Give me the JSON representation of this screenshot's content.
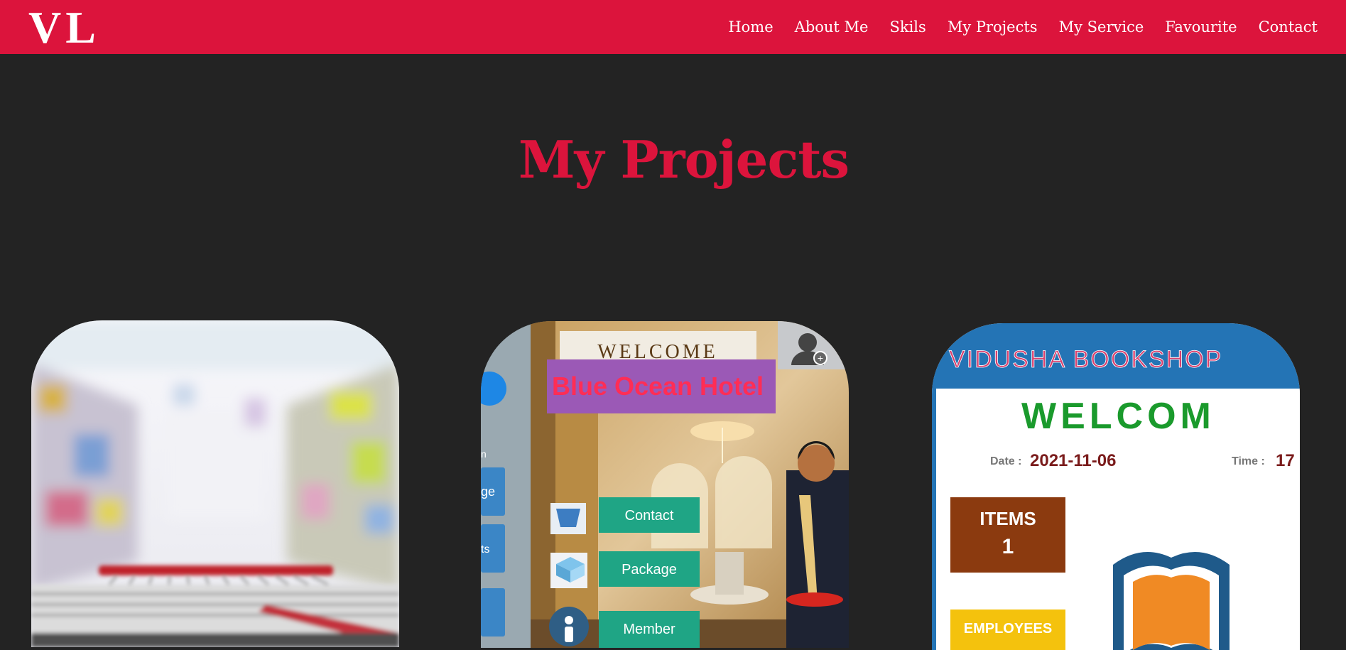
{
  "brand": {
    "logo": "VL"
  },
  "nav": {
    "links": [
      {
        "label": "Home"
      },
      {
        "label": "About Me"
      },
      {
        "label": "Skils"
      },
      {
        "label": "My Projects"
      },
      {
        "label": "My Service"
      },
      {
        "label": "Favourite"
      },
      {
        "label": "Contact"
      }
    ]
  },
  "section": {
    "title": "My Projects"
  },
  "projects": [
    {
      "name": "supermarket-project",
      "colors": {
        "shelf": "#e7eef3",
        "cart": "#c0202a"
      }
    },
    {
      "name": "hotel-project",
      "welcome": "WELCOME",
      "hotel_name": "Blue Ocean Hotel",
      "sidebar_fragments": [
        "n",
        "ge",
        "ts"
      ],
      "buttons": [
        "Contact",
        "Package",
        "Member"
      ],
      "colors": {
        "button": "#1fa585",
        "banner": "#9b59b6",
        "hotel_name": "#ff2d55"
      }
    },
    {
      "name": "bookshop-project",
      "header": "VIDUSHA BOOKSHOP",
      "welcome": "WELCOM",
      "date_label": "Date :",
      "date_value": "2021-11-06",
      "time_label": "Time :",
      "time_value": "17",
      "items_label": "ITEMS",
      "items_value": "1",
      "employees_label": "EMPLOYEES",
      "colors": {
        "header": "#2474b5",
        "welcome": "#1a9a2c",
        "items_box": "#8b3a0f",
        "employees_box": "#f4c20d"
      }
    }
  ]
}
